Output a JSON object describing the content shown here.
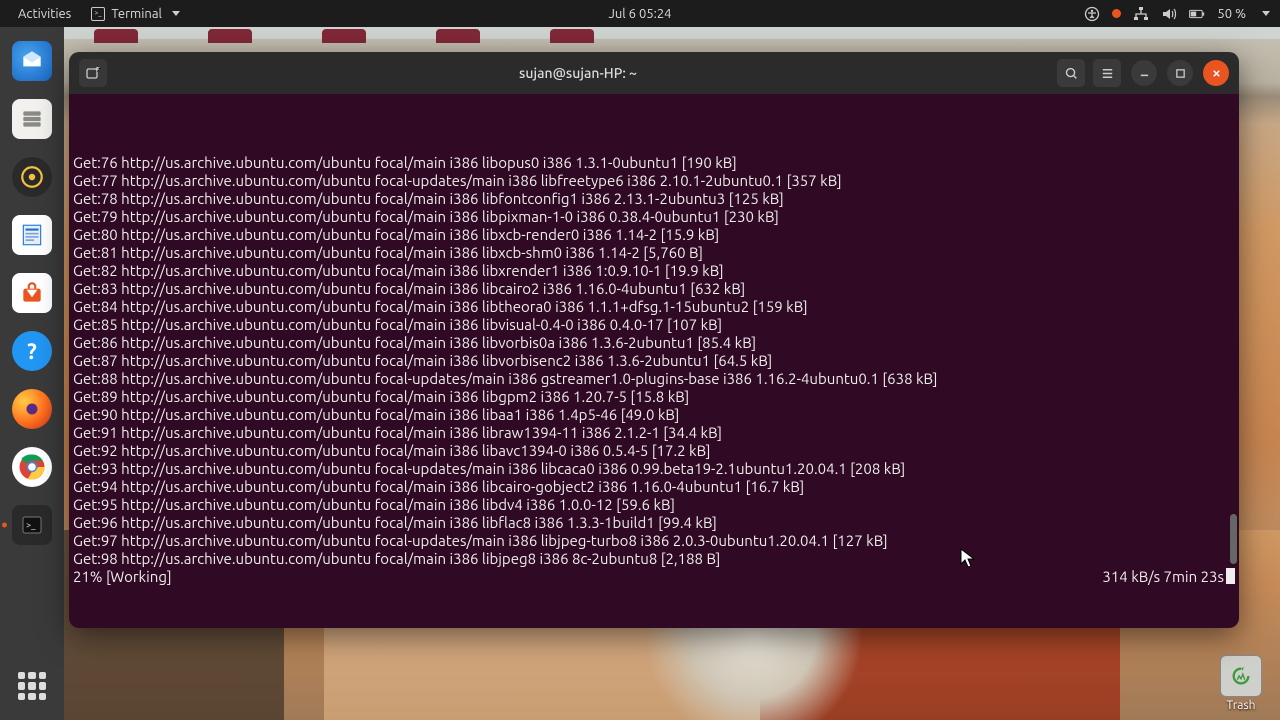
{
  "topbar": {
    "activities": "Activities",
    "app_label": "Terminal",
    "datetime": "Jul 6  05:24",
    "battery_pct": "50 %"
  },
  "dock": {
    "apps": [
      "thunderbird",
      "files",
      "rhythmbox",
      "libreoffice-writer",
      "software",
      "help",
      "firefox",
      "chrome",
      "terminal"
    ]
  },
  "desktop": {
    "trash_label": "Trash"
  },
  "terminal": {
    "title": "sujan@sujan-HP: ~",
    "lines": [
      "Get:76 http://us.archive.ubuntu.com/ubuntu focal/main i386 libopus0 i386 1.3.1-0ubuntu1 [190 kB]",
      "Get:77 http://us.archive.ubuntu.com/ubuntu focal-updates/main i386 libfreetype6 i386 2.10.1-2ubuntu0.1 [357 kB]",
      "Get:78 http://us.archive.ubuntu.com/ubuntu focal/main i386 libfontconfig1 i386 2.13.1-2ubuntu3 [125 kB]",
      "Get:79 http://us.archive.ubuntu.com/ubuntu focal/main i386 libpixman-1-0 i386 0.38.4-0ubuntu1 [230 kB]",
      "Get:80 http://us.archive.ubuntu.com/ubuntu focal/main i386 libxcb-render0 i386 1.14-2 [15.9 kB]",
      "Get:81 http://us.archive.ubuntu.com/ubuntu focal/main i386 libxcb-shm0 i386 1.14-2 [5,760 B]",
      "Get:82 http://us.archive.ubuntu.com/ubuntu focal/main i386 libxrender1 i386 1:0.9.10-1 [19.9 kB]",
      "Get:83 http://us.archive.ubuntu.com/ubuntu focal/main i386 libcairo2 i386 1.16.0-4ubuntu1 [632 kB]",
      "Get:84 http://us.archive.ubuntu.com/ubuntu focal/main i386 libtheora0 i386 1.1.1+dfsg.1-15ubuntu2 [159 kB]",
      "Get:85 http://us.archive.ubuntu.com/ubuntu focal/main i386 libvisual-0.4-0 i386 0.4.0-17 [107 kB]",
      "Get:86 http://us.archive.ubuntu.com/ubuntu focal/main i386 libvorbis0a i386 1.3.6-2ubuntu1 [85.4 kB]",
      "Get:87 http://us.archive.ubuntu.com/ubuntu focal/main i386 libvorbisenc2 i386 1.3.6-2ubuntu1 [64.5 kB]",
      "Get:88 http://us.archive.ubuntu.com/ubuntu focal-updates/main i386 gstreamer1.0-plugins-base i386 1.16.2-4ubuntu0.1 [638 kB]",
      "Get:89 http://us.archive.ubuntu.com/ubuntu focal/main i386 libgpm2 i386 1.20.7-5 [15.8 kB]",
      "Get:90 http://us.archive.ubuntu.com/ubuntu focal/main i386 libaa1 i386 1.4p5-46 [49.0 kB]",
      "Get:91 http://us.archive.ubuntu.com/ubuntu focal/main i386 libraw1394-11 i386 2.1.2-1 [34.4 kB]",
      "Get:92 http://us.archive.ubuntu.com/ubuntu focal/main i386 libavc1394-0 i386 0.5.4-5 [17.2 kB]",
      "Get:93 http://us.archive.ubuntu.com/ubuntu focal-updates/main i386 libcaca0 i386 0.99.beta19-2.1ubuntu1.20.04.1 [208 kB]",
      "Get:94 http://us.archive.ubuntu.com/ubuntu focal/main i386 libcairo-gobject2 i386 1.16.0-4ubuntu1 [16.7 kB]",
      "Get:95 http://us.archive.ubuntu.com/ubuntu focal/main i386 libdv4 i386 1.0.0-12 [59.6 kB]",
      "Get:96 http://us.archive.ubuntu.com/ubuntu focal/main i386 libflac8 i386 1.3.3-1build1 [99.4 kB]",
      "Get:97 http://us.archive.ubuntu.com/ubuntu focal-updates/main i386 libjpeg-turbo8 i386 2.0.3-0ubuntu1.20.04.1 [127 kB]",
      "Get:98 http://us.archive.ubuntu.com/ubuntu focal/main i386 libjpeg8 i386 8c-2ubuntu8 [2,188 B]"
    ],
    "status_left": "21% [Working]",
    "status_right": "314 kB/s 7min 23s"
  }
}
